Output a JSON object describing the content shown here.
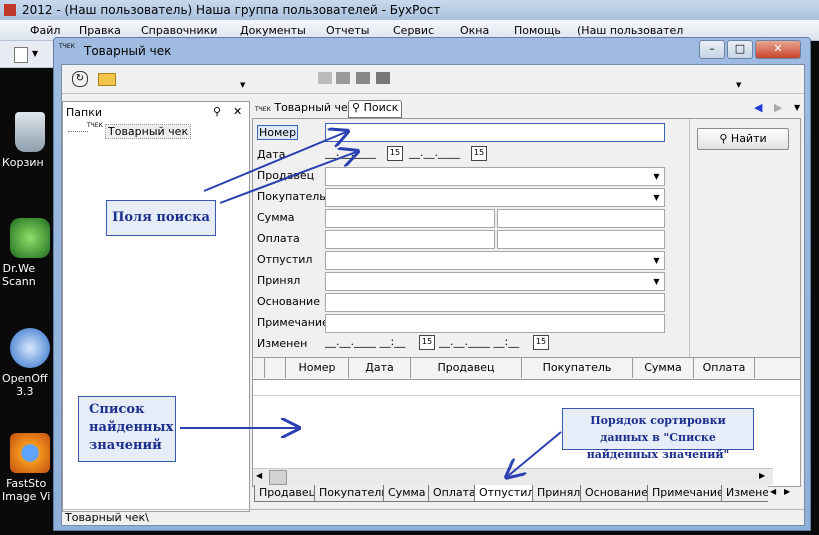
{
  "app": {
    "title": "2012 - (Наш пользователь) Наша группа пользователей - БухРост",
    "menu": [
      "Файл",
      "Правка",
      "Справочники",
      "Документы",
      "Отчеты",
      "Сервис",
      "Окна",
      "Помощь",
      "(Наш пользовател"
    ]
  },
  "desktop": {
    "icons": [
      {
        "label": "Корзин",
        "icon": "recycle-bin-icon"
      },
      {
        "label": "Dr.We\nScann",
        "icon": "drweb-icon"
      },
      {
        "label": "OpenOff\n3.3",
        "icon": "openoffice-icon"
      },
      {
        "label": "FastSto\nImage Vi",
        "icon": "faststone-icon"
      }
    ]
  },
  "window": {
    "title": "Товарный чек",
    "min": "–",
    "max": "□",
    "close": "✕",
    "status": "Товарный чек\\"
  },
  "folders": {
    "header": "Папки",
    "close": "✕",
    "item": "Товарный чек"
  },
  "tabs": {
    "doc": "Товарный чек",
    "search": "Поиск"
  },
  "search": {
    "find_button": "Найти",
    "labels": {
      "number": "Номер",
      "date": "Дата",
      "seller": "Продавец",
      "buyer": "Покупатель",
      "sum": "Сумма",
      "payment": "Оплата",
      "released": "Отпустил",
      "accepted": "Принял",
      "basis": "Основание",
      "note": "Примечание",
      "changed": "Изменен"
    },
    "date_mask": "__.__.____",
    "datetime_mask": "__.__.____ __:__",
    "cal": "15"
  },
  "grid": {
    "columns": [
      "Номер",
      "Дата",
      "Продавец",
      "Покупатель",
      "Сумма",
      "Оплата"
    ]
  },
  "sort_tabs": [
    "Продавец",
    "Покупатель",
    "Сумма",
    "Оплата",
    "Отпустил",
    "Принял",
    "Основание",
    "Примечание",
    "Изменен"
  ],
  "callouts": {
    "fields": "Поля поиска",
    "list": "Список\nнайденных\nзначений",
    "order": "Порядок сортировки данных в \"Списке найденных значений\""
  }
}
